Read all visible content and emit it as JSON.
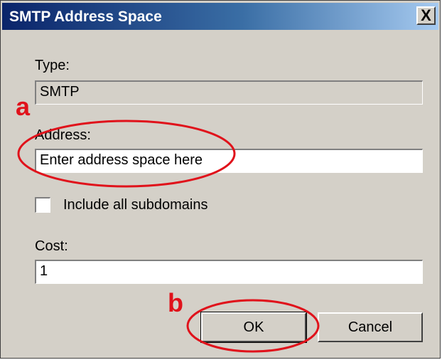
{
  "window": {
    "title": "SMTP Address Space",
    "close_glyph": "X"
  },
  "type_field": {
    "label": "Type:",
    "value": "SMTP"
  },
  "address_field": {
    "label": "Address:",
    "value": "Enter address space here"
  },
  "subdomains": {
    "label": "Include all subdomains",
    "checked": false
  },
  "cost_field": {
    "label": "Cost:",
    "value": "1"
  },
  "buttons": {
    "ok": "OK",
    "cancel": "Cancel"
  },
  "annotations": {
    "a": "a",
    "b": "b",
    "color": "#e0121b"
  }
}
